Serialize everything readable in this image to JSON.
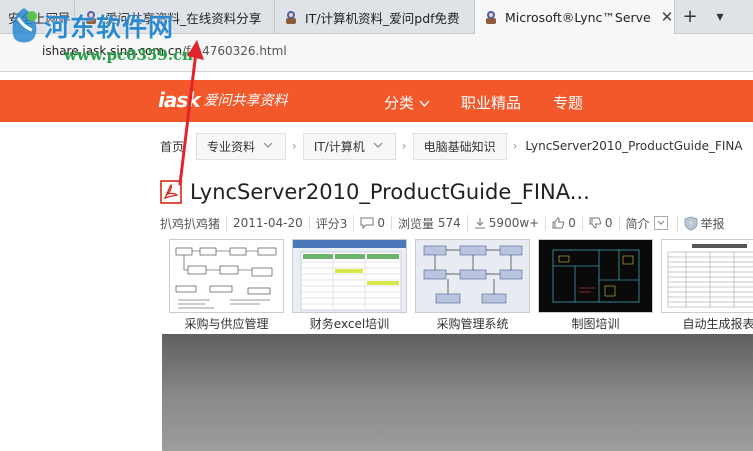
{
  "tabs": [
    {
      "title": "安全上网导",
      "active": false
    },
    {
      "title": "爱问共享资料_在线资料分享",
      "active": false
    },
    {
      "title": "IT/计算机资料_爱问pdf免费",
      "active": false
    },
    {
      "title": "Microsoft®Lync™Serve",
      "active": true
    }
  ],
  "tab_actions": {
    "new_tab": "+",
    "dropdown": "⌄"
  },
  "address": {
    "host": "ishare.iask.sina.com.cn",
    "path": "/f/14760326.html"
  },
  "watermark": {
    "title": "河东软件网",
    "url": "www.pc0359.cn"
  },
  "header": {
    "logo_iask": "iask",
    "logo_brand": "爱问共享资料",
    "nav": [
      "分类",
      "职业精品",
      "专题"
    ]
  },
  "breadcrumb": {
    "home": "首页",
    "items": [
      "专业资料",
      "IT/计算机",
      "电脑基础知识"
    ],
    "current": "LyncServer2010_ProductGuide_FINA"
  },
  "document": {
    "title": "LyncServer2010_ProductGuide_FINA...",
    "author": "扒鸡扒鸡猪",
    "date": "2011-04-20",
    "score": "评分3",
    "comments": "0",
    "views_label": "浏览量",
    "views": "574",
    "downloads": "5900w+",
    "likes": "0",
    "dislikes": "0",
    "intro": "简介",
    "report": "举报"
  },
  "thumbnails": [
    {
      "caption": "采购与供应管理"
    },
    {
      "caption": "财务excel培训"
    },
    {
      "caption": "采购管理系统"
    },
    {
      "caption": "制图培训"
    },
    {
      "caption": "自动生成报表"
    }
  ],
  "colors": {
    "accent": "#f2582a",
    "annotation": "#e0242a",
    "watermark_blue": "#2a8ad0",
    "watermark_green": "#28a048"
  }
}
